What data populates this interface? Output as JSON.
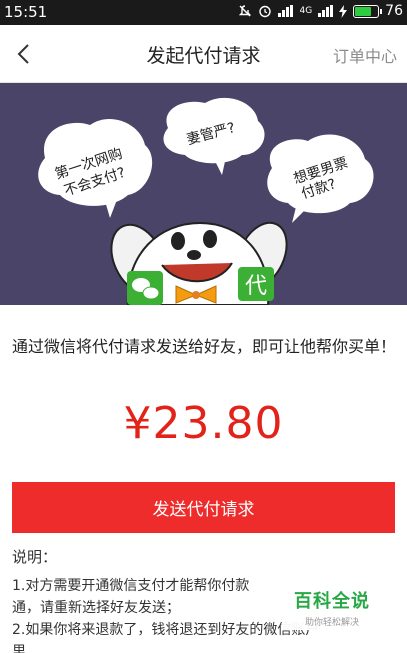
{
  "status_bar": {
    "time": "15:51",
    "network": "4G",
    "battery_level": "76",
    "battery_fraction": 0.76
  },
  "nav": {
    "back_icon": "chevron-left-icon",
    "title": "发起代付请求",
    "right_link": "订单中心"
  },
  "banner": {
    "bubble_1": [
      "第一次网购",
      "不会支付?"
    ],
    "bubble_2": "妻管严?",
    "bubble_3": [
      "想要男票",
      "付款?"
    ],
    "badge_label": "代",
    "colors": {
      "background": "#4a4469",
      "badge": "#3cb034",
      "wechat": "#3cb034"
    }
  },
  "description": "通过微信将代付请求发送给好友，即可让他帮你买单！",
  "amount": "¥23.80",
  "send_button": "发送代付请求",
  "notes": {
    "title": "说明：",
    "items": [
      "1.对方需要开通微信支付才能帮你付款",
      "通，请重新选择好友发送；",
      "2.如果你将来退款了，钱将退还到好友的微信账户",
      "里"
    ]
  },
  "watermark": {
    "main": "百科全说",
    "sub": "助你轻松解决"
  },
  "colors": {
    "accent": "#ee2c2c",
    "amount": "#e2231a",
    "status_bar": "#1a1a1a"
  }
}
